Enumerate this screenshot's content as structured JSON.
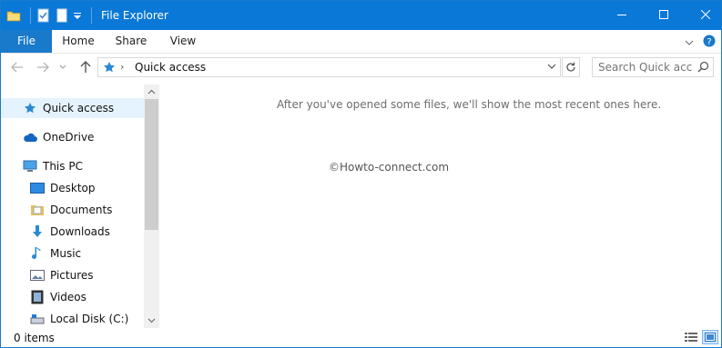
{
  "window": {
    "title": "File Explorer",
    "colors": {
      "titlebar": "#0a78d7",
      "file_tab": "#1979ca",
      "selection": "#cce8ff"
    }
  },
  "quick_access_toolbar": {
    "icons": [
      "folder-icon",
      "properties-icon",
      "new-folder-icon",
      "customize-dropdown-icon"
    ]
  },
  "ribbon": {
    "tabs": [
      {
        "label": "File"
      },
      {
        "label": "Home"
      },
      {
        "label": "Share"
      },
      {
        "label": "View"
      }
    ]
  },
  "address_bar": {
    "breadcrumb": "Quick access"
  },
  "search": {
    "placeholder": "Search Quick acc..."
  },
  "navigation_pane": {
    "items": [
      {
        "label": "Quick access",
        "icon": "star-icon"
      },
      {
        "label": "OneDrive",
        "icon": "cloud-icon"
      },
      {
        "label": "This PC",
        "icon": "computer-icon"
      },
      {
        "label": "Desktop",
        "icon": "desktop-icon"
      },
      {
        "label": "Documents",
        "icon": "documents-icon"
      },
      {
        "label": "Downloads",
        "icon": "download-icon"
      },
      {
        "label": "Music",
        "icon": "music-icon"
      },
      {
        "label": "Pictures",
        "icon": "pictures-icon"
      },
      {
        "label": "Videos",
        "icon": "videos-icon"
      },
      {
        "label": "Local Disk (C:)",
        "icon": "drive-icon"
      }
    ]
  },
  "content": {
    "empty_message": "After you've opened some files, we'll show the most recent ones here.",
    "watermark": "©Howto-connect.com"
  },
  "status_bar": {
    "item_count": "0 items"
  }
}
